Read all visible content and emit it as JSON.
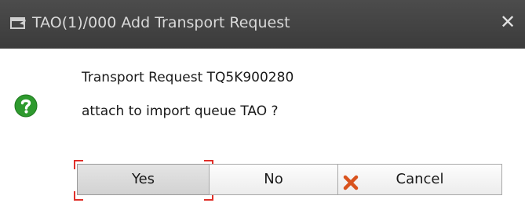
{
  "window": {
    "title": "TAO(1)/000 Add Transport Request",
    "title_icon": "window-icon",
    "close_glyph": "✕"
  },
  "message": {
    "icon": "question-icon",
    "line1": "Transport Request TQ5K900280",
    "line2": "attach to import queue TAO ?"
  },
  "buttons": {
    "yes_label": "Yes",
    "no_label": "No",
    "cancel_label": "Cancel",
    "cancel_icon": "cancel-x-icon",
    "focused": "Yes"
  },
  "colors": {
    "titlebar": "#424242",
    "question_icon": "#2e9a2e",
    "cancel_icon": "#d9531e",
    "focus_marker": "#e0302a"
  }
}
